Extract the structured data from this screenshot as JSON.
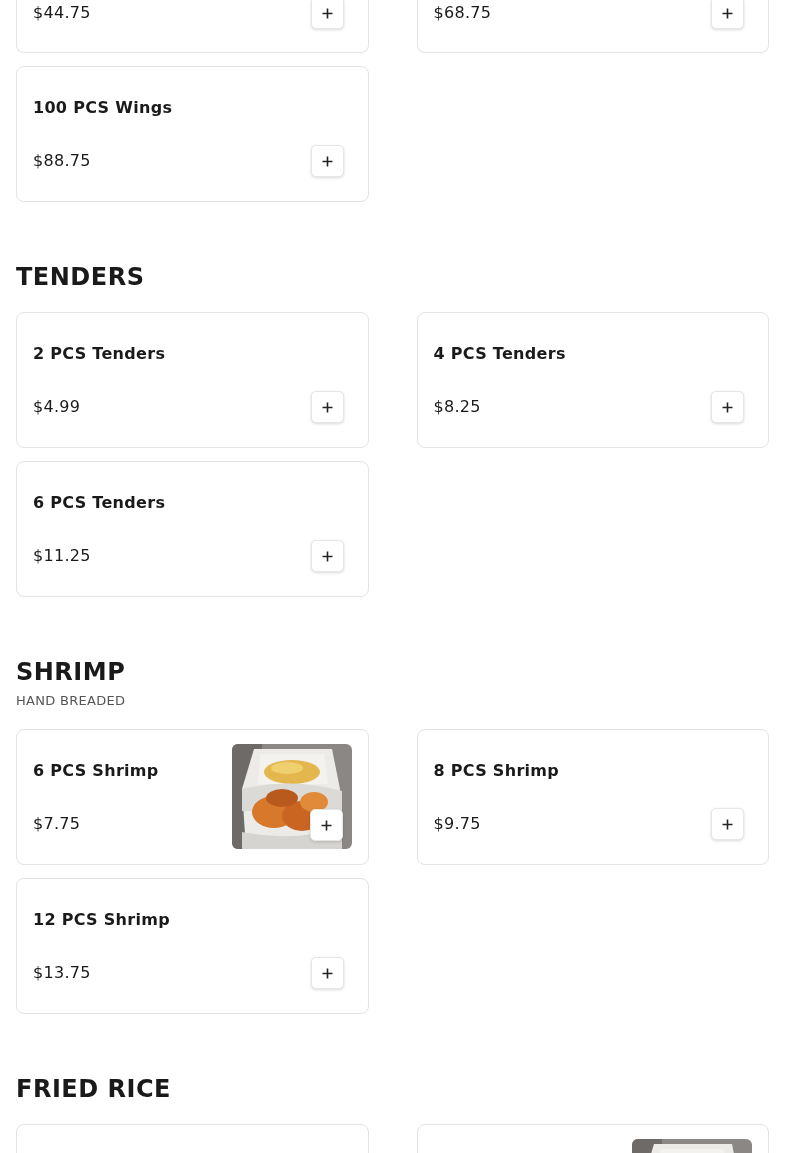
{
  "sections": [
    {
      "items": [
        {
          "price": "$44.75",
          "picture": false
        },
        {
          "price": "$68.75",
          "picture": false
        },
        {
          "name": "100 PCS Wings",
          "price": "$88.75",
          "picture": false
        }
      ]
    },
    {
      "title": "TENDERS",
      "items": [
        {
          "name": "2 PCS Tenders",
          "price": "$4.99",
          "picture": false
        },
        {
          "name": "4 PCS Tenders",
          "price": "$8.25",
          "picture": false
        },
        {
          "name": "6 PCS Tenders",
          "price": "$11.25",
          "picture": false
        }
      ]
    },
    {
      "title": "SHRIMP",
      "subtitle": "HAND BREADED",
      "items": [
        {
          "name": "6 PCS Shrimp",
          "price": "$7.75",
          "picture": true
        },
        {
          "name": "8 PCS Shrimp",
          "price": "$9.75",
          "picture": false
        },
        {
          "name": "12 PCS Shrimp",
          "price": "$13.75",
          "picture": false
        }
      ]
    },
    {
      "title": "FRIED RICE",
      "items": [
        {
          "picture": false
        },
        {
          "picture": true
        }
      ]
    }
  ]
}
